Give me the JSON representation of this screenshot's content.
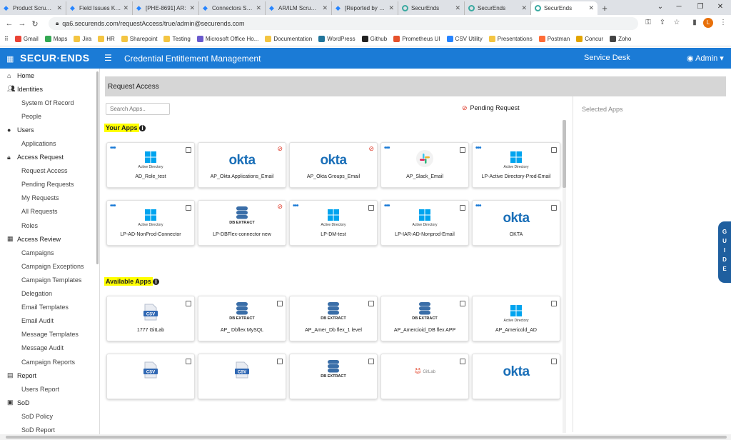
{
  "browser": {
    "tabs": [
      {
        "label": "Product Scrum S",
        "icon": "jira-icon"
      },
      {
        "label": "Field Issues Kanb",
        "icon": "jira-icon"
      },
      {
        "label": "[PHE-8691] AR:",
        "icon": "jira-icon"
      },
      {
        "label": "Connectors Scru",
        "icon": "jira-icon"
      },
      {
        "label": "AR/ILM Scrum B",
        "icon": "jira-icon"
      },
      {
        "label": "[Reported by me",
        "icon": "jira-icon"
      },
      {
        "label": "SecurEnds",
        "icon": "securends-icon"
      },
      {
        "label": "SecurEnds",
        "icon": "securends-icon"
      },
      {
        "label": "SecurEnds",
        "icon": "securends-icon",
        "active": true
      }
    ],
    "url": "qa6.securends.com/requestAccess/true/admin@securends.com",
    "bookmarks": [
      "Gmail",
      "Maps",
      "Jira",
      "HR",
      "Sharepoint",
      "Testing",
      "Microsoft Office Ho...",
      "Documentation",
      "WordPress",
      "Github",
      "Prometheus UI",
      "CSV Utility",
      "Presentations",
      "Postman",
      "Concur",
      "Zoho"
    ],
    "profile_initial": "L"
  },
  "header": {
    "logo": "SECUR·ENDS",
    "title": "Credential Entitlement Management",
    "service_desk": "Service Desk",
    "user": "Admin ▾"
  },
  "sidebar": [
    {
      "label": "Home",
      "type": "section",
      "icon": "home-icon"
    },
    {
      "label": "Identities",
      "type": "section",
      "icon": "users-icon"
    },
    {
      "label": "System Of Record",
      "type": "sub"
    },
    {
      "label": "People",
      "type": "sub"
    },
    {
      "label": "Users",
      "type": "section",
      "icon": "user-icon"
    },
    {
      "label": "Applications",
      "type": "sub"
    },
    {
      "label": "Access Request",
      "type": "section",
      "icon": "lock-icon"
    },
    {
      "label": "Request Access",
      "type": "sub"
    },
    {
      "label": "Pending Requests",
      "type": "sub"
    },
    {
      "label": "My Requests",
      "type": "sub"
    },
    {
      "label": "All Requests",
      "type": "sub"
    },
    {
      "label": "Roles",
      "type": "sub"
    },
    {
      "label": "Access Review",
      "type": "section",
      "icon": "grid-icon"
    },
    {
      "label": "Campaigns",
      "type": "sub"
    },
    {
      "label": "Campaign Exceptions",
      "type": "sub"
    },
    {
      "label": "Campaign Templates",
      "type": "sub"
    },
    {
      "label": "Delegation",
      "type": "sub"
    },
    {
      "label": "Email Templates",
      "type": "sub"
    },
    {
      "label": "Email Audit",
      "type": "sub"
    },
    {
      "label": "Message Templates",
      "type": "sub"
    },
    {
      "label": "Message Audit",
      "type": "sub"
    },
    {
      "label": "Campaign Reports",
      "type": "sub"
    },
    {
      "label": "Report",
      "type": "section",
      "icon": "report-icon"
    },
    {
      "label": "Users Report",
      "type": "sub"
    },
    {
      "label": "SoD",
      "type": "section",
      "icon": "sod-icon"
    },
    {
      "label": "SoD Policy",
      "type": "sub"
    },
    {
      "label": "SoD Report",
      "type": "sub"
    }
  ],
  "main": {
    "section_title": "Request Access",
    "search_placeholder": "Search Apps..",
    "pending_label": "Pending Request",
    "selected_label": "Selected Apps",
    "your_apps_title": "Your Apps",
    "available_apps_title": "Available Apps",
    "your_apps": [
      {
        "name": "AD_Role_test",
        "logo": "windows",
        "sub": "Active Directory",
        "dots": true,
        "state": "checkbox"
      },
      {
        "name": "AP_Okta Applications_Email",
        "logo": "okta",
        "state": "pending"
      },
      {
        "name": "AP_Okta Groups_Email",
        "logo": "okta",
        "state": "pending"
      },
      {
        "name": "AP_Slack_Email",
        "logo": "slack",
        "dots": true,
        "state": "checkbox"
      },
      {
        "name": "LP-Active Directory-Prod-Email",
        "logo": "windows",
        "sub": "Active Directory",
        "dots": true,
        "state": "checkbox"
      },
      {
        "name": "LP-AD-NonProd-Connector",
        "logo": "windows",
        "sub": "Active Directory",
        "dots": true,
        "state": "checkbox"
      },
      {
        "name": "LP-DBFlex-connector new",
        "logo": "db",
        "sub": "DB EXTRACT",
        "state": "pending"
      },
      {
        "name": "LP-DM-test",
        "logo": "windows",
        "sub": "Active Directory",
        "dots": true,
        "state": "checkbox"
      },
      {
        "name": "LP-IAR-AD-Nonprod-Email",
        "logo": "windows",
        "sub": "Active Directory",
        "dots": true,
        "state": "checkbox"
      },
      {
        "name": "OKTA",
        "logo": "okta",
        "dots": true,
        "state": "checkbox"
      }
    ],
    "available_apps": [
      {
        "name": "1777 GitLab",
        "logo": "csv",
        "state": "checkbox"
      },
      {
        "name": "AP_ Dbflex MySQL",
        "logo": "db",
        "sub": "DB EXTRACT",
        "state": "checkbox"
      },
      {
        "name": "AP_Amer_Db flex_1 level",
        "logo": "db",
        "sub": "DB EXTRACT",
        "state": "checkbox"
      },
      {
        "name": "AP_Amercioid_DB flex APP",
        "logo": "db",
        "sub": "DB EXTRACT",
        "state": "checkbox"
      },
      {
        "name": "AP_Americold_AD",
        "logo": "windows",
        "sub": "Active Directory",
        "state": "checkbox"
      },
      {
        "name": "",
        "logo": "csv",
        "state": "checkbox"
      },
      {
        "name": "",
        "logo": "csv",
        "state": "checkbox"
      },
      {
        "name": "",
        "logo": "db",
        "sub": "DB EXTRACT",
        "state": "checkbox"
      },
      {
        "name": "",
        "logo": "gitlab",
        "sub": "GitLab",
        "state": "checkbox"
      },
      {
        "name": "",
        "logo": "okta",
        "state": "checkbox"
      }
    ]
  },
  "guide": "GUIDE",
  "colors": {
    "brand": "#1b7bd6",
    "pending": "#dd3322",
    "highlight": "#ffff00"
  }
}
